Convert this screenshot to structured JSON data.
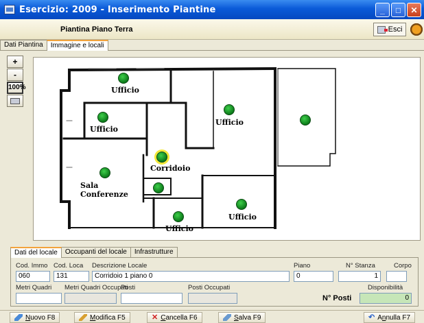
{
  "window": {
    "title": "Esercizio: 2009 - Inserimento Piantine"
  },
  "header": {
    "title": "Piantina Piano Terra",
    "exit_label": "Esci"
  },
  "top_tabs": [
    {
      "label": "Dati Piantina"
    },
    {
      "label": "Immagine e locali"
    }
  ],
  "zoom": {
    "plus": "+",
    "minus": "-",
    "level": "100%"
  },
  "rooms": [
    {
      "label": "Ufficio"
    },
    {
      "label": "Ufficio"
    },
    {
      "label": "Ufficio"
    },
    {
      "label": "Corridoio"
    },
    {
      "label": "Sala\nConferenze"
    },
    {
      "label": "Ufficio"
    },
    {
      "label": "Ufficio"
    }
  ],
  "bottom_tabs": [
    {
      "label": "Dati del locale"
    },
    {
      "label": "Occupanti del locale"
    },
    {
      "label": "Infrastrutture"
    }
  ],
  "form": {
    "cod_immo_label": "Cod. Immo",
    "cod_immo": "060",
    "cod_loca_label": "Cod. Loca",
    "cod_loca": "131",
    "descrizione_label": "Descrizione Locale",
    "descrizione": "Corridoio 1 piano 0",
    "piano_label": "Piano",
    "piano": "0",
    "n_stanza_label": "N° Stanza",
    "n_stanza": "1",
    "corpo_label": "Corpo",
    "corpo": "",
    "metri_quadri_label": "Metri Quadri",
    "metri_quadri": "",
    "metri_occ_label": "Metri Quadri Occupati",
    "metri_occ": "",
    "posti_label": "Posti",
    "posti": "",
    "posti_occ_label": "Posti Occupati",
    "posti_occ": "",
    "n_posti_label": "N° Posti",
    "disponibilita_label": "Disponibilità",
    "disponibilita": "0"
  },
  "toolbar": {
    "nuovo_key": "N",
    "nuovo_rest": "uovo F8",
    "modifica_key": "M",
    "modifica_rest": "odifica F5",
    "cancella_key": "C",
    "cancella_rest": "ancella F6",
    "salva_key": "S",
    "salva_rest": "alva F9",
    "annulla_pre": "A",
    "annulla_key": "n",
    "annulla_rest": "nulla F7"
  },
  "colors": {
    "title_bar": "#0a5ad8",
    "marker": "#1aa52a",
    "selected_highlight": "#f2e838",
    "availability": "#c6e6b8"
  }
}
